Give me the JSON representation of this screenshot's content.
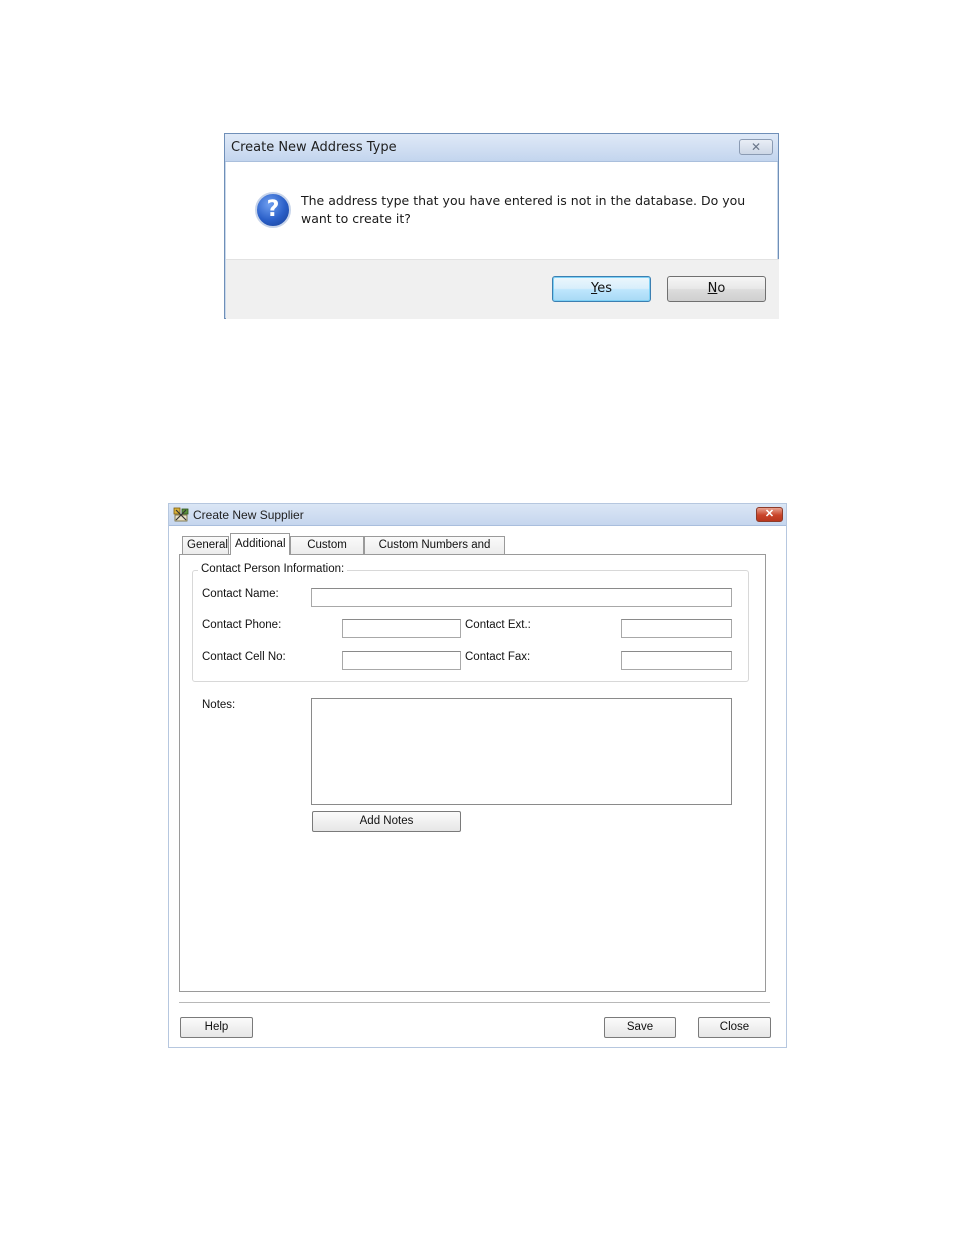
{
  "address_dialog": {
    "title": "Create New Address Type",
    "close_glyph": "✕",
    "icon": "question-icon",
    "icon_glyph": "?",
    "message": "The address type that you have entered is not in the database. Do you want to create it?",
    "yes_hotkey": "Y",
    "yes_rest": "es",
    "no_hotkey": "N",
    "no_rest": "o"
  },
  "supplier_dialog": {
    "title": "Create New Supplier",
    "close_glyph": "✕",
    "tabs": [
      "General",
      "Additional",
      "Custom Texts",
      "Custom Numbers and Dates"
    ],
    "active_tab": "Additional",
    "group_title": "Contact Person Information:",
    "labels": {
      "contact_name": "Contact Name:",
      "contact_phone": "Contact Phone:",
      "contact_ext": "Contact Ext.:",
      "contact_cell": "Contact Cell No:",
      "contact_fax": "Contact Fax:",
      "notes": "Notes:"
    },
    "values": {
      "contact_name": "",
      "contact_phone": "",
      "contact_ext": "",
      "contact_cell": "",
      "contact_fax": "",
      "notes": ""
    },
    "buttons": {
      "add_notes": "Add Notes",
      "help": "Help",
      "save": "Save",
      "close": "Close"
    }
  },
  "colors": {
    "title_bar": "#c6d6ee",
    "close_red": "#c9442a",
    "default_button": "#bee6fd"
  }
}
